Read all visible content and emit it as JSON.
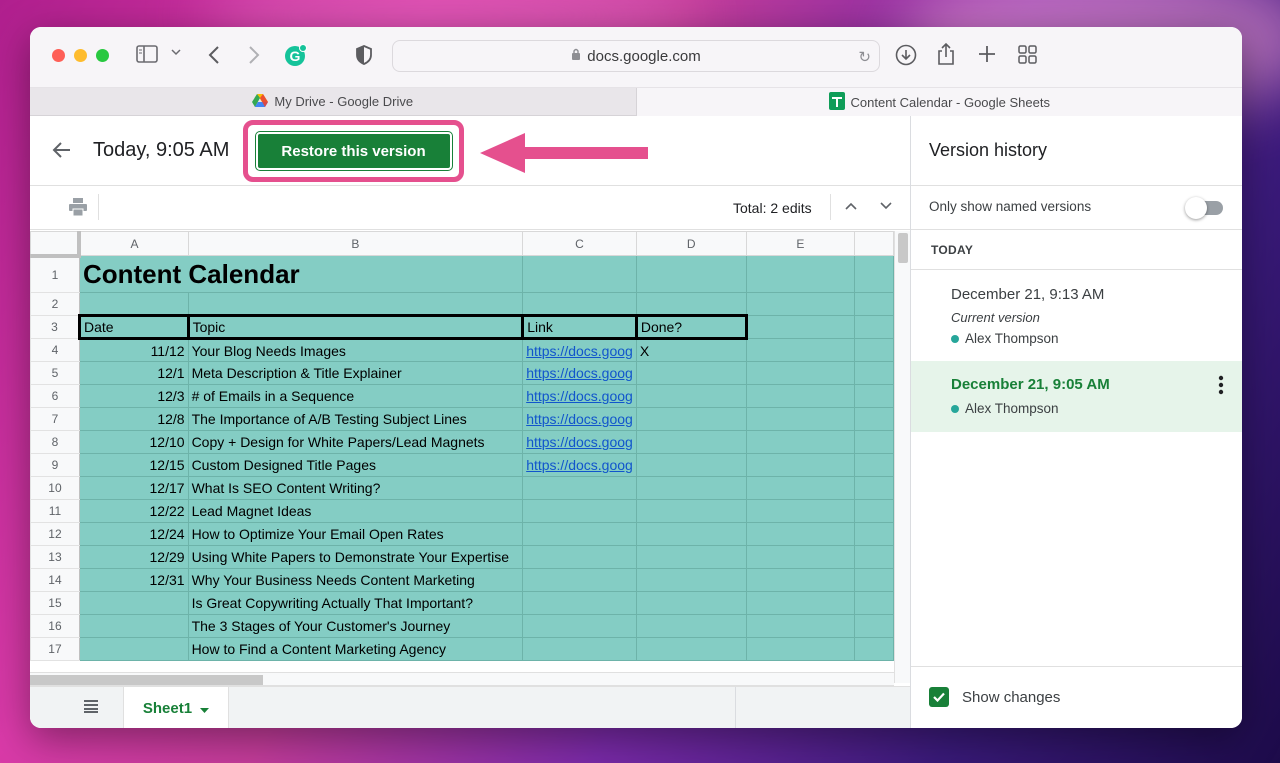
{
  "browser": {
    "url": "docs.google.com",
    "tabs": [
      {
        "label": "My Drive - Google Drive",
        "icon": "google-drive-icon",
        "active": false
      },
      {
        "label": "Content Calendar - Google Sheets",
        "icon": "google-sheets-icon",
        "active": true
      }
    ]
  },
  "header": {
    "version_title": "Today, 9:05 AM",
    "restore_label": "Restore this version",
    "highlight_color": "#e5508e",
    "accent_color": "#188038"
  },
  "toolbar": {
    "total_edits": "Total: 2 edits"
  },
  "sheet": {
    "columns": [
      "A",
      "B",
      "C",
      "D",
      "E"
    ],
    "title": "Content Calendar",
    "header_row": [
      "Date",
      "Topic",
      "Link",
      "Done?"
    ],
    "rows": [
      {
        "n": "1"
      },
      {
        "n": "2"
      },
      {
        "n": "3"
      },
      {
        "n": "4",
        "date": "11/12",
        "topic": "Your Blog Needs Images",
        "link": "https://docs.goog",
        "done": "X"
      },
      {
        "n": "5",
        "date": "12/1",
        "topic": "Meta Description & Title Explainer",
        "link": "https://docs.goog",
        "done": ""
      },
      {
        "n": "6",
        "date": "12/3",
        "topic": "# of Emails in a Sequence",
        "link": "https://docs.goog",
        "done": ""
      },
      {
        "n": "7",
        "date": "12/8",
        "topic": "The Importance of A/B Testing Subject Lines",
        "link": "https://docs.goog",
        "done": ""
      },
      {
        "n": "8",
        "date": "12/10",
        "topic": "Copy + Design for White Papers/Lead Magnets",
        "link": "https://docs.goog",
        "done": ""
      },
      {
        "n": "9",
        "date": "12/15",
        "topic": "Custom Designed Title Pages",
        "link": "https://docs.goog",
        "done": ""
      },
      {
        "n": "10",
        "date": "12/17",
        "topic": "What Is SEO Content Writing?",
        "link": "",
        "done": ""
      },
      {
        "n": "11",
        "date": "12/22",
        "topic": "Lead Magnet Ideas",
        "link": "",
        "done": ""
      },
      {
        "n": "12",
        "date": "12/24",
        "topic": "How to Optimize Your Email Open Rates",
        "link": "",
        "done": ""
      },
      {
        "n": "13",
        "date": "12/29",
        "topic": "Using White Papers to Demonstrate Your Expertise",
        "link": "",
        "done": ""
      },
      {
        "n": "14",
        "date": "12/31",
        "topic": "Why Your Business Needs Content Marketing",
        "link": "",
        "done": ""
      },
      {
        "n": "15",
        "date": "",
        "topic": "Is Great Copywriting Actually That Important?",
        "link": "",
        "done": ""
      },
      {
        "n": "16",
        "date": "",
        "topic": "The 3 Stages of Your Customer's Journey",
        "link": "",
        "done": ""
      },
      {
        "n": "17",
        "date": "",
        "topic": "How to Find a Content Marketing Agency",
        "link": "",
        "done": ""
      }
    ],
    "fill_color": "#84cdc4",
    "sheet_tab": "Sheet1"
  },
  "panel": {
    "title": "Version history",
    "only_named_label": "Only show named versions",
    "only_named_on": false,
    "group_label": "TODAY",
    "versions": [
      {
        "date": "December 21, 9:13 AM",
        "note": "Current version",
        "author": "Alex Thompson",
        "selected": false
      },
      {
        "date": "December 21, 9:05 AM",
        "author": "Alex Thompson",
        "selected": true
      }
    ],
    "show_changes_label": "Show changes",
    "show_changes_checked": true
  }
}
